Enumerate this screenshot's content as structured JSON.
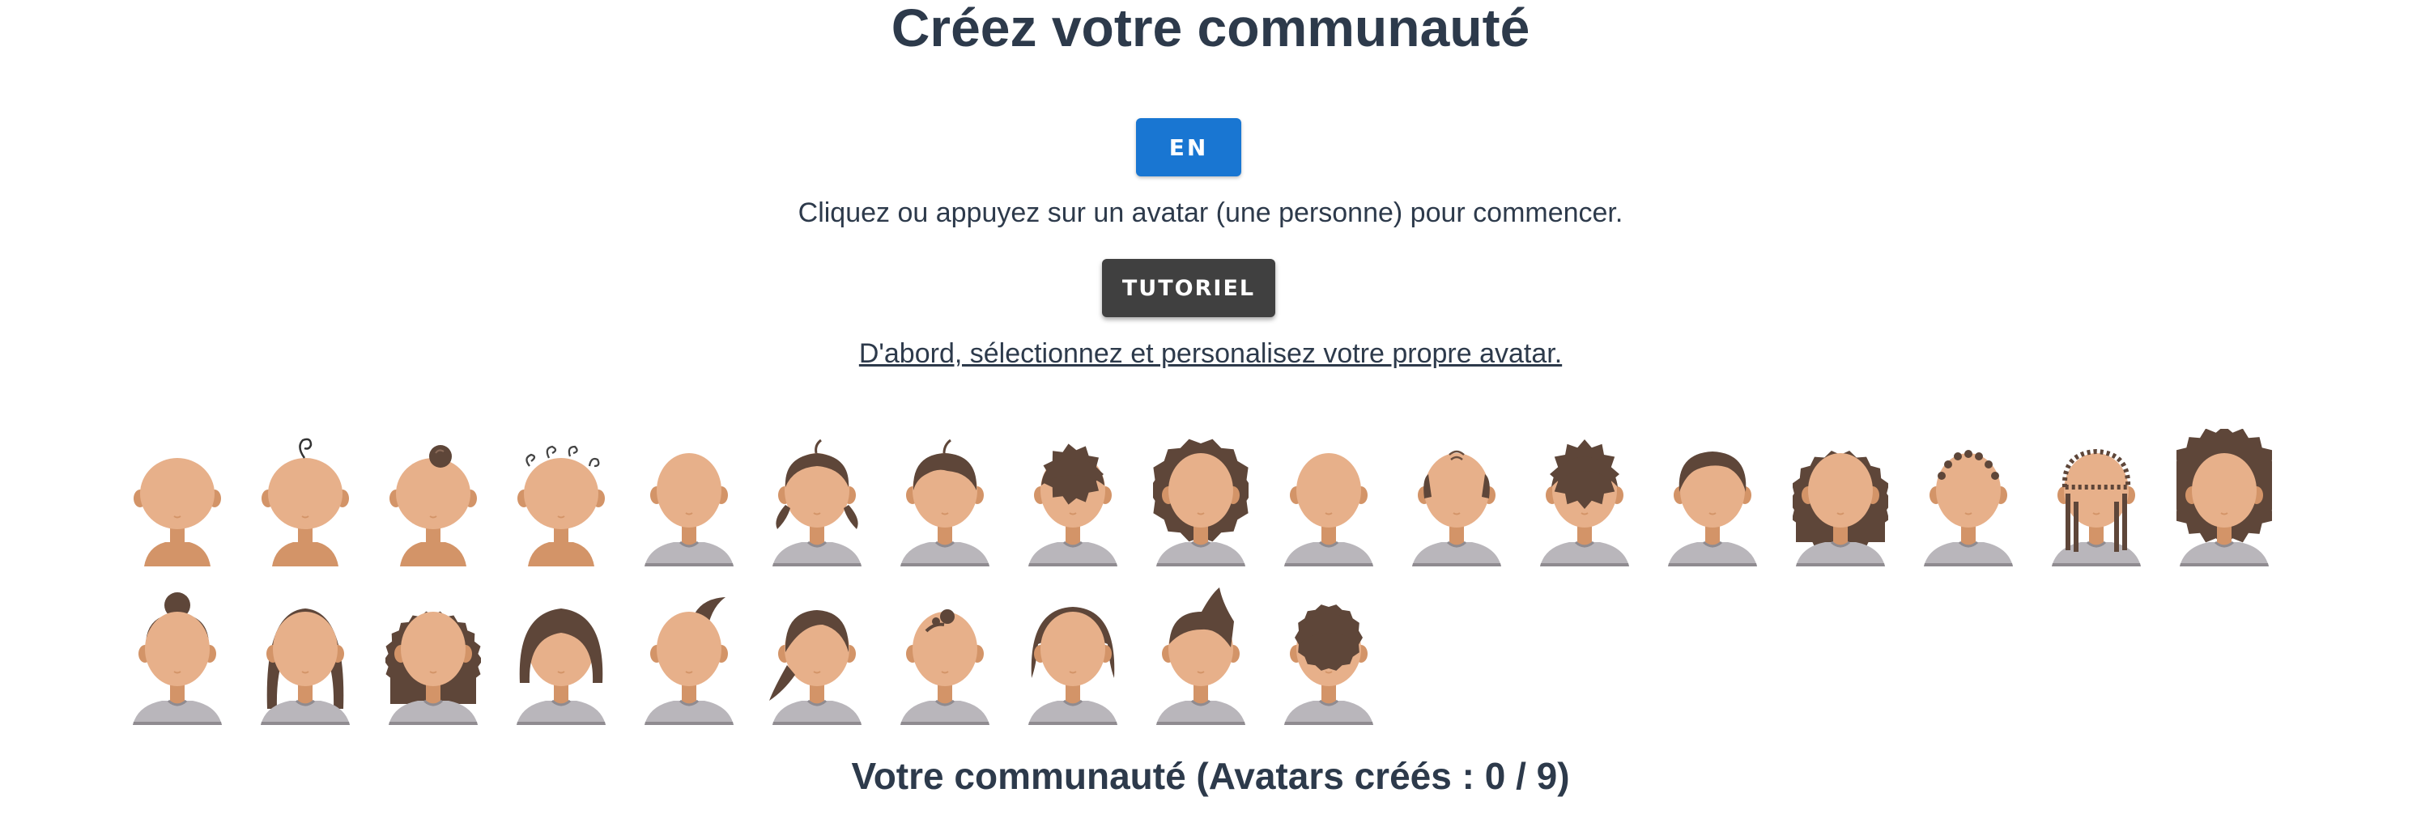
{
  "page": {
    "title": "Créez votre communauté",
    "lang_button": "EN",
    "instructions": "Cliquez ou appuyez sur un avatar (une personne) pour commencer.",
    "tutorial_button": "TUTORIEL",
    "hint": "D'abord, sélectionnez et personalisez votre propre avatar.",
    "footer": "Votre communauté (Avatars créés : 0 / 9)"
  },
  "colors": {
    "skin": "#e7b08a",
    "skin_shade": "#d39468",
    "hair": "#5e4639",
    "shirt": "#b9b6bb",
    "primary": "#1976d2",
    "dark_button": "#404040",
    "text": "#2d3a4b"
  },
  "avatars": {
    "row1": [
      {
        "icon": "baby-bald-avatar-icon"
      },
      {
        "icon": "baby-curl-avatar-icon"
      },
      {
        "icon": "baby-topknot-avatar-icon"
      },
      {
        "icon": "baby-curls-avatar-icon"
      },
      {
        "icon": "bald-avatar-icon"
      },
      {
        "icon": "pigtails-avatar-icon"
      },
      {
        "icon": "short-hair-avatar-icon"
      },
      {
        "icon": "curly-short-avatar-icon"
      },
      {
        "icon": "curly-medium-avatar-icon"
      },
      {
        "icon": "shaved-avatar-icon"
      },
      {
        "icon": "balding-avatar-icon"
      },
      {
        "icon": "spiky-curly-avatar-icon"
      },
      {
        "icon": "side-part-avatar-icon"
      },
      {
        "icon": "long-curly-avatar-icon"
      },
      {
        "icon": "short-cropped-avatar-icon"
      },
      {
        "icon": "long-braids-avatar-icon"
      },
      {
        "icon": "afro-avatar-icon"
      }
    ],
    "row2": [
      {
        "icon": "top-bun-avatar-icon"
      },
      {
        "icon": "long-straight-avatar-icon"
      },
      {
        "icon": "long-wavy-avatar-icon"
      },
      {
        "icon": "bob-avatar-icon"
      },
      {
        "icon": "swoop-avatar-icon"
      },
      {
        "icon": "ponytail-avatar-icon"
      },
      {
        "icon": "small-bun-avatar-icon"
      },
      {
        "icon": "bangs-bob-avatar-icon"
      },
      {
        "icon": "pompadour-avatar-icon"
      },
      {
        "icon": "buzz-curls-avatar-icon"
      }
    ]
  }
}
